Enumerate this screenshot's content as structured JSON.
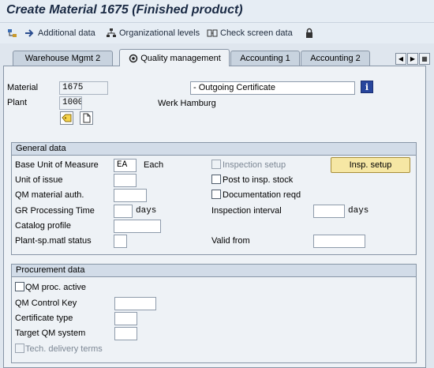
{
  "window": {
    "title": "Create Material 1675 (Finished product)"
  },
  "toolbar": {
    "items": [
      {
        "label": "",
        "icon": "hierarchy-icon"
      },
      {
        "label": "Additional data",
        "icon": "arrow-right-icon"
      },
      {
        "label": "Organizational levels",
        "icon": "org-levels-icon"
      },
      {
        "label": "Check screen data",
        "icon": "check-data-icon"
      },
      {
        "label": "",
        "icon": "lock-icon"
      }
    ]
  },
  "tabs": [
    {
      "label": "Warehouse Mgmt 2"
    },
    {
      "label": "Quality management",
      "active": true
    },
    {
      "label": "Accounting 1"
    },
    {
      "label": "Accounting 2"
    }
  ],
  "header": {
    "material_label": "Material",
    "material_value": "1675",
    "material_desc": "- Outgoing Certificate",
    "plant_label": "Plant",
    "plant_value": "1000",
    "plant_name": "Werk Hamburg"
  },
  "general": {
    "title": "General data",
    "base_uom_label": "Base Unit of Measure",
    "base_uom_value": "EA",
    "base_uom_text": "Each",
    "unit_issue_label": "Unit of issue",
    "qm_auth_label": "QM material auth.",
    "gr_time_label": "GR Processing Time",
    "gr_time_unit": "days",
    "catalog_label": "Catalog profile",
    "plant_status_label": "Plant-sp.matl status",
    "insp_setup_label": "Inspection setup",
    "post_insp_label": "Post to insp. stock",
    "doc_reqd_label": "Documentation reqd",
    "insp_interval_label": "Inspection interval",
    "insp_interval_unit": "days",
    "valid_from_label": "Valid from",
    "insp_setup_button": "Insp. setup"
  },
  "procurement": {
    "title": "Procurement data",
    "qm_proc_label": "QM proc. active",
    "qm_control_label": "QM Control Key",
    "cert_type_label": "Certificate type",
    "target_qm_label": "Target QM system",
    "tech_delivery_label": "Tech. delivery terms"
  },
  "colors": {
    "accent": "#27459c",
    "button": "#f6e7a4",
    "panel": "#eef2f6"
  }
}
